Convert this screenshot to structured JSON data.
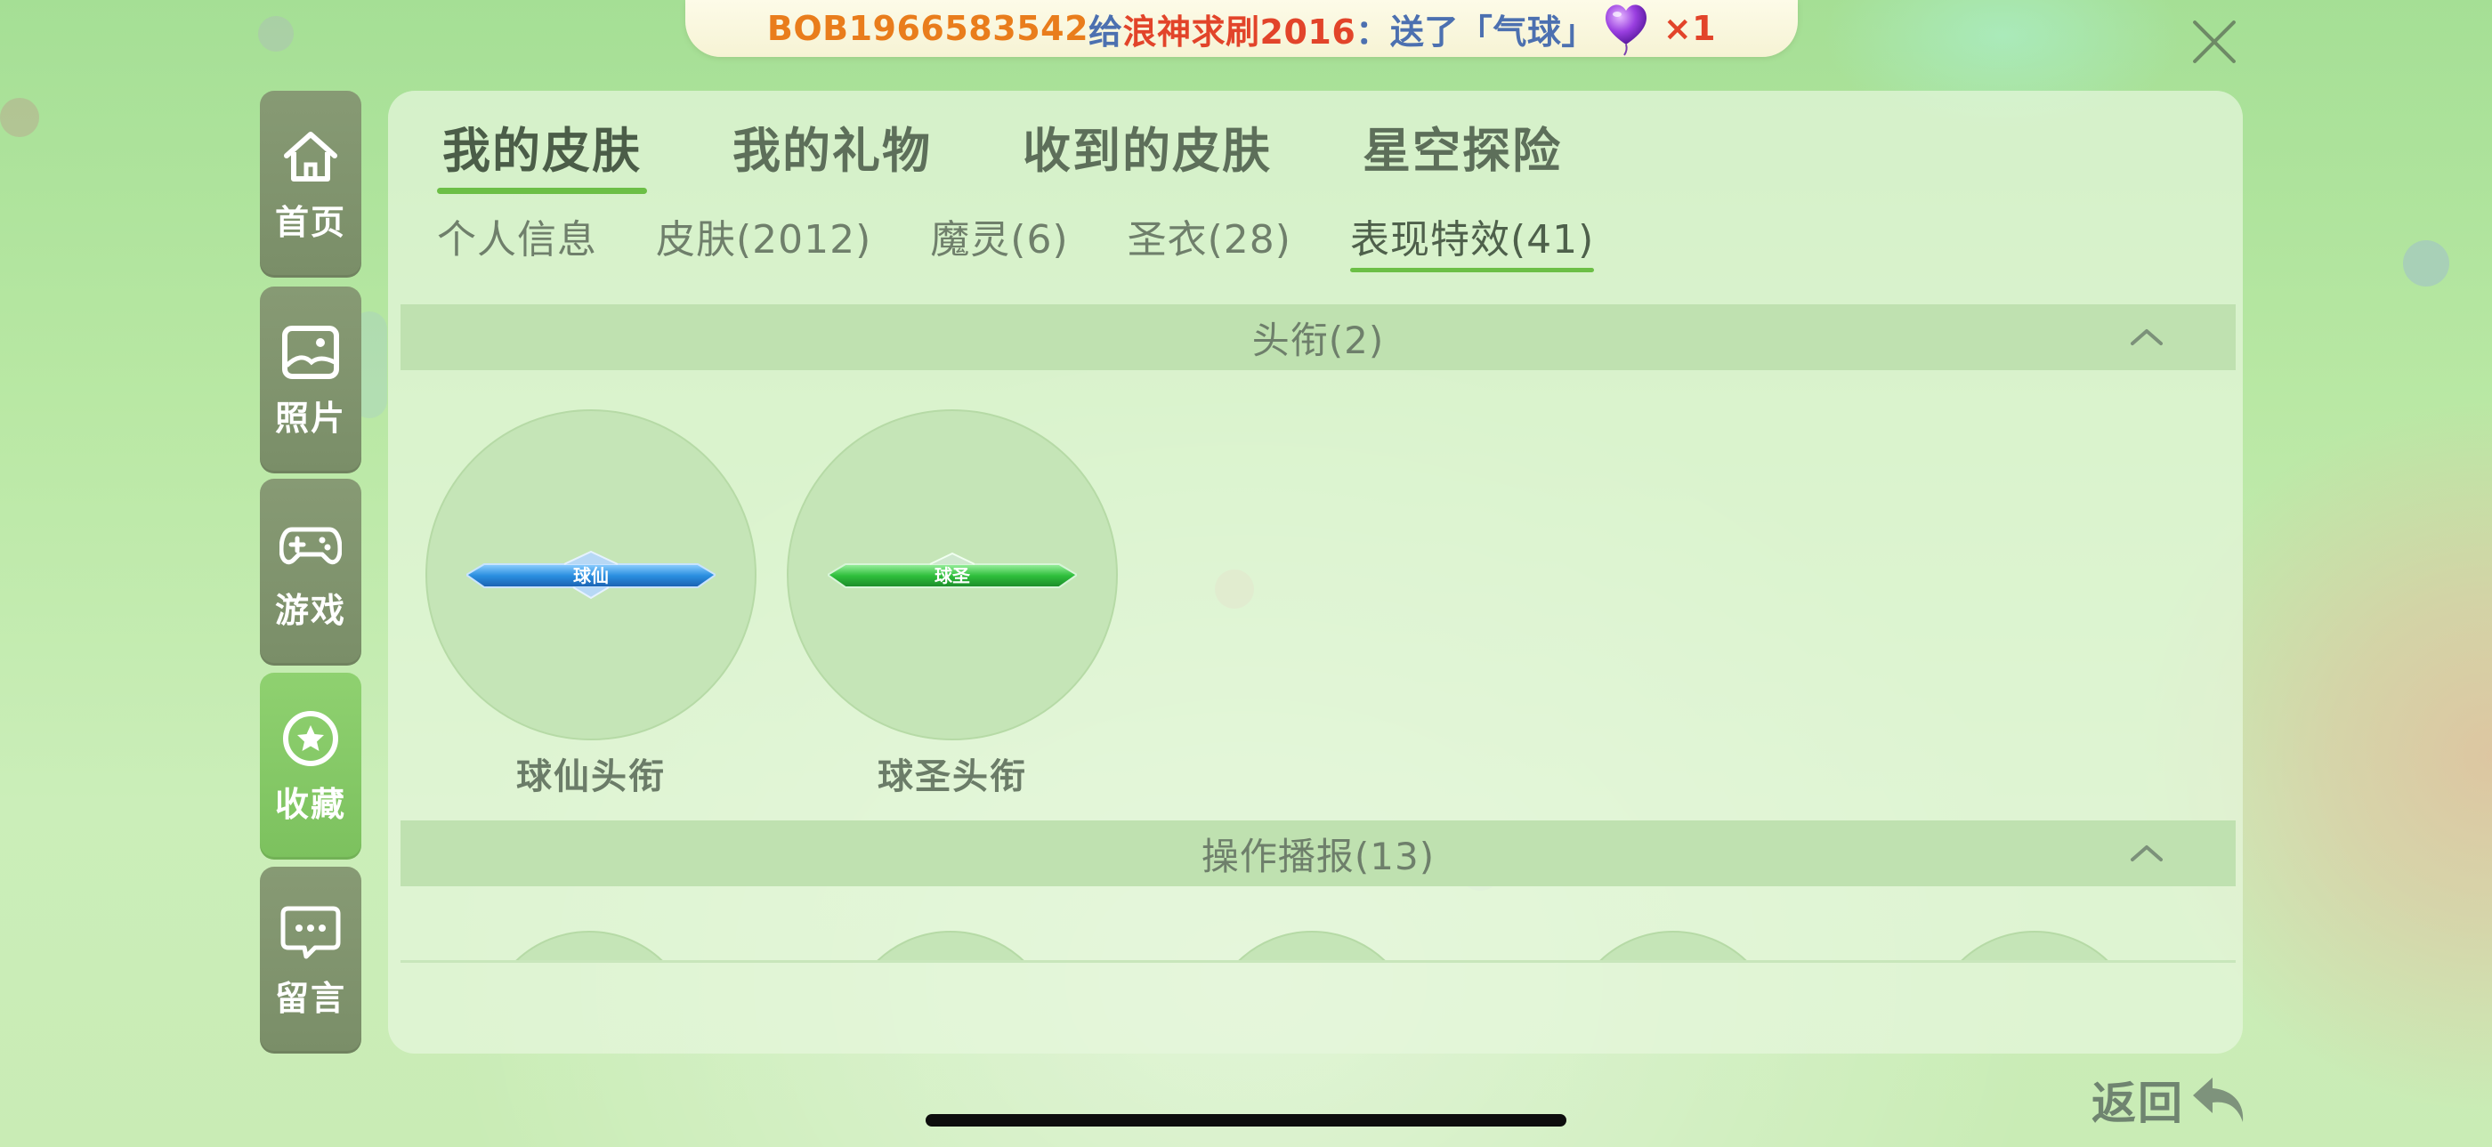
{
  "banner": {
    "user": "BOB1966583542",
    "verb_give": "给",
    "recipient": "浪神求刷2016",
    "sep": "：",
    "sent": "送了",
    "gift": "「气球」",
    "count": "×1"
  },
  "sidebar": {
    "items": [
      {
        "label": "首页",
        "icon": "home-icon"
      },
      {
        "label": "照片",
        "icon": "photo-icon"
      },
      {
        "label": "游戏",
        "icon": "gamepad-icon"
      },
      {
        "label": "收藏",
        "icon": "star-icon",
        "active": true
      },
      {
        "label": "留言",
        "icon": "message-icon"
      }
    ]
  },
  "tabs": [
    "我的皮肤",
    "我的礼物",
    "收到的皮肤",
    "星空探险"
  ],
  "subtabs": [
    "个人信息",
    "皮肤(2012)",
    "魔灵(6)",
    "圣衣(28)",
    "表现特效(41)"
  ],
  "sections": [
    {
      "title": "头衔(2)",
      "items": [
        {
          "name": "球仙头衔",
          "badge": "球仙",
          "color": "#2a8fe0"
        },
        {
          "name": "球圣头衔",
          "badge": "球圣",
          "color": "#2fbf3c"
        }
      ]
    },
    {
      "title": "操作播报(13)"
    }
  ],
  "back_label": "返回",
  "colors": {
    "accent_green": "#6cbf46",
    "sidebar_bg": "#879a74",
    "sidebar_active": "#8fd170"
  }
}
